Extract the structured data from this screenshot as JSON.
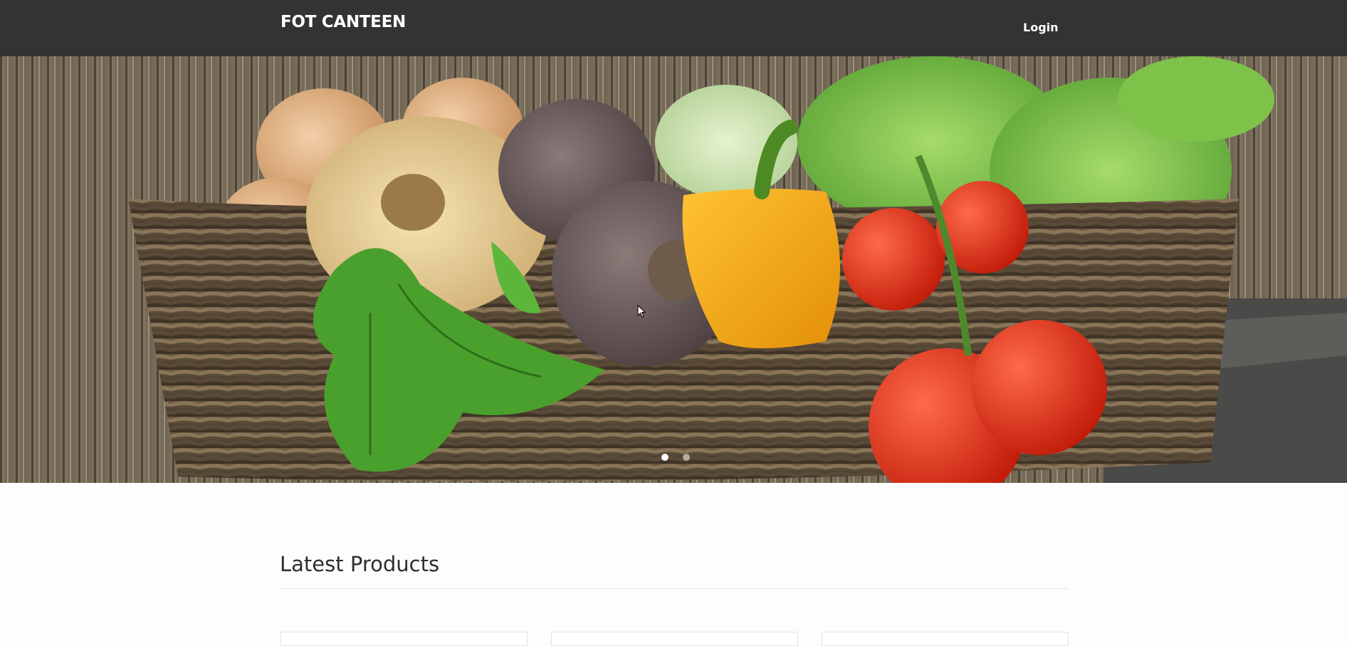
{
  "navbar": {
    "brand": "FOT CANTEEN",
    "login_label": "Login"
  },
  "hero": {
    "image": "vegetable-basket-photo",
    "slides": 2,
    "active_slide": 1
  },
  "main": {
    "section_title": "Latest Products",
    "product_cards": 3
  },
  "colors": {
    "navbar_bg": "#333333",
    "page_bg": "#fdfdfd",
    "text_dark": "#2e2e2e"
  }
}
